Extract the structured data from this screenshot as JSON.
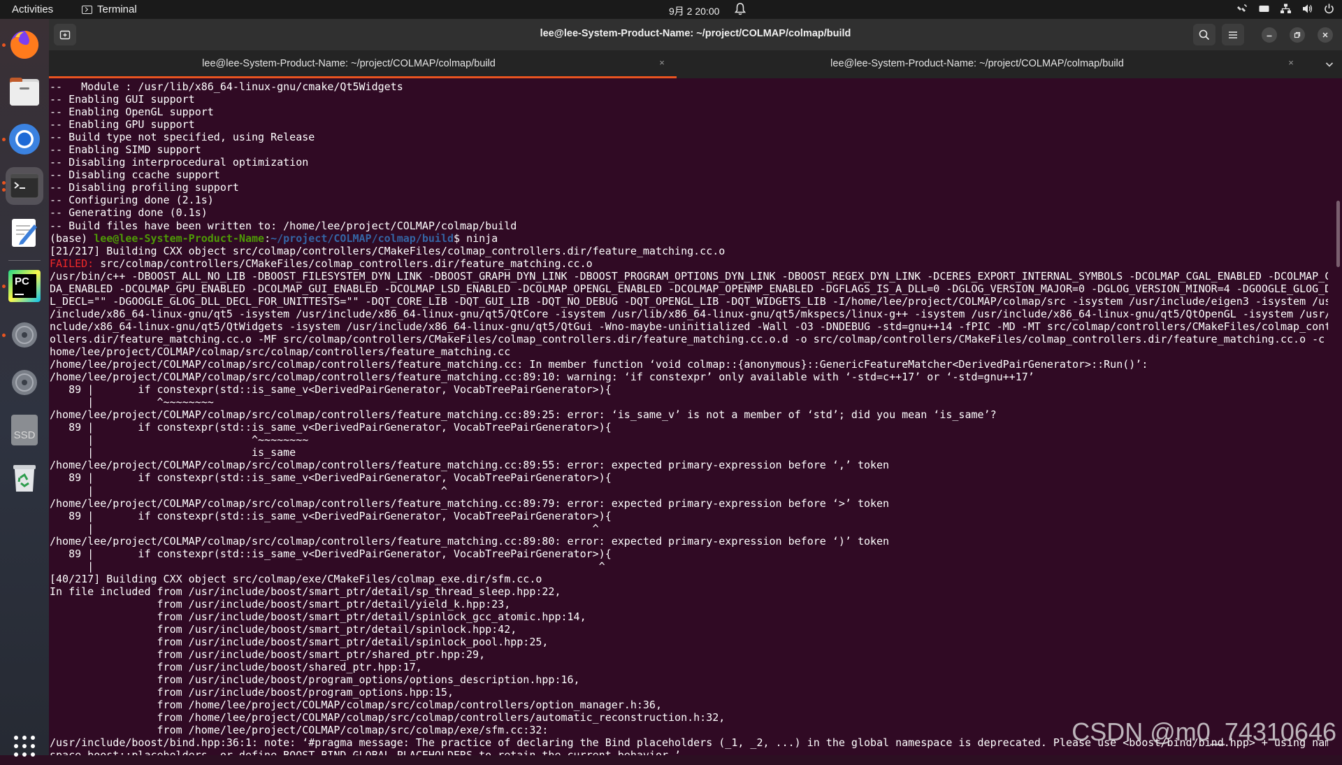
{
  "topbar": {
    "activities": "Activities",
    "app_name": "Terminal",
    "clock": "9月 2  20:00"
  },
  "dock": {
    "items": [
      "firefox-icon",
      "files-icon",
      "chromium-icon",
      "terminal-icon",
      "text-editor-icon",
      "pycharm-icon",
      "disc-icon",
      "disc-icon",
      "ssd-drive-icon",
      "trash-icon",
      "show-apps-icon"
    ],
    "ssd_label": "SSD",
    "pycharm_label": "PC"
  },
  "window": {
    "title": "lee@lee-System-Product-Name: ~/project/COLMAP/colmap/build",
    "tabs": [
      {
        "label": "lee@lee-System-Product-Name: ~/project/COLMAP/colmap/build",
        "active": true
      },
      {
        "label": "lee@lee-System-Product-Name: ~/project/COLMAP/colmap/build",
        "active": false
      }
    ],
    "tab_close": "×"
  },
  "terminal": {
    "lines_before": [
      "--   Module : /usr/lib/x86_64-linux-gnu/cmake/Qt5Widgets",
      "-- Enabling GUI support",
      "-- Enabling OpenGL support",
      "-- Enabling GPU support",
      "-- Build type not specified, using Release",
      "-- Enabling SIMD support",
      "-- Disabling interprocedural optimization",
      "-- Disabling ccache support",
      "-- Disabling profiling support",
      "-- Configuring done (2.1s)",
      "-- Generating done (0.1s)",
      "-- Build files have been written to: /home/lee/project/COLMAP/colmap/build"
    ],
    "prompt": {
      "env": "(base) ",
      "user_host": "lee@lee-System-Product-Name",
      "colon": ":",
      "path": "~/project/COLMAP/colmap/build",
      "symbol": "$ ",
      "command": "ninja"
    },
    "build_line": "[21/217] Building CXX object src/colmap/controllers/CMakeFiles/colmap_controllers.dir/feature_matching.cc.o",
    "failed_label": "FAILED:",
    "failed_target": " src/colmap/controllers/CMakeFiles/colmap_controllers.dir/feature_matching.cc.o",
    "lines_after": [
      "/usr/bin/c++ -DBOOST_ALL_NO_LIB -DBOOST_FILESYSTEM_DYN_LINK -DBOOST_GRAPH_DYN_LINK -DBOOST_PROGRAM_OPTIONS_DYN_LINK -DBOOST_REGEX_DYN_LINK -DCERES_EXPORT_INTERNAL_SYMBOLS -DCOLMAP_CGAL_ENABLED -DCOLMAP_CU",
      "DA_ENABLED -DCOLMAP_GPU_ENABLED -DCOLMAP_GUI_ENABLED -DCOLMAP_LSD_ENABLED -DCOLMAP_OPENGL_ENABLED -DCOLMAP_OPENMP_ENABLED -DGFLAGS_IS_A_DLL=0 -DGLOG_VERSION_MAJOR=0 -DGLOG_VERSION_MINOR=4 -DGOOGLE_GLOG_DL",
      "L_DECL=\"\" -DGOOGLE_GLOG_DLL_DECL_FOR_UNITTESTS=\"\" -DQT_CORE_LIB -DQT_GUI_LIB -DQT_NO_DEBUG -DQT_OPENGL_LIB -DQT_WIDGETS_LIB -I/home/lee/project/COLMAP/colmap/src -isystem /usr/include/eigen3 -isystem /usr",
      "/include/x86_64-linux-gnu/qt5 -isystem /usr/include/x86_64-linux-gnu/qt5/QtCore -isystem /usr/lib/x86_64-linux-gnu/qt5/mkspecs/linux-g++ -isystem /usr/include/x86_64-linux-gnu/qt5/QtOpenGL -isystem /usr/i",
      "nclude/x86_64-linux-gnu/qt5/QtWidgets -isystem /usr/include/x86_64-linux-gnu/qt5/QtGui -Wno-maybe-uninitialized -Wall -O3 -DNDEBUG -std=gnu++14 -fPIC -MD -MT src/colmap/controllers/CMakeFiles/colmap_contr",
      "ollers.dir/feature_matching.cc.o -MF src/colmap/controllers/CMakeFiles/colmap_controllers.dir/feature_matching.cc.o.d -o src/colmap/controllers/CMakeFiles/colmap_controllers.dir/feature_matching.cc.o -c /",
      "home/lee/project/COLMAP/colmap/src/colmap/controllers/feature_matching.cc",
      "/home/lee/project/COLMAP/colmap/src/colmap/controllers/feature_matching.cc: In member function ‘void colmap::{anonymous}::GenericFeatureMatcher<DerivedPairGenerator>::Run()’:",
      "/home/lee/project/COLMAP/colmap/src/colmap/controllers/feature_matching.cc:89:10: warning: ‘if constexpr’ only available with ‘-std=c++17’ or ‘-std=gnu++17’",
      "   89 |       if constexpr(std::is_same_v<DerivedPairGenerator, VocabTreePairGenerator>){",
      "      |          ^~~~~~~~~",
      "/home/lee/project/COLMAP/colmap/src/colmap/controllers/feature_matching.cc:89:25: error: ‘is_same_v’ is not a member of ‘std’; did you mean ‘is_same’?",
      "   89 |       if constexpr(std::is_same_v<DerivedPairGenerator, VocabTreePairGenerator>){",
      "      |                         ^~~~~~~~~",
      "      |                         is_same",
      "/home/lee/project/COLMAP/colmap/src/colmap/controllers/feature_matching.cc:89:55: error: expected primary-expression before ‘,’ token",
      "   89 |       if constexpr(std::is_same_v<DerivedPairGenerator, VocabTreePairGenerator>){",
      "      |                                                       ^",
      "/home/lee/project/COLMAP/colmap/src/colmap/controllers/feature_matching.cc:89:79: error: expected primary-expression before ‘>’ token",
      "   89 |       if constexpr(std::is_same_v<DerivedPairGenerator, VocabTreePairGenerator>){",
      "      |                                                                               ^",
      "/home/lee/project/COLMAP/colmap/src/colmap/controllers/feature_matching.cc:89:80: error: expected primary-expression before ‘)’ token",
      "   89 |       if constexpr(std::is_same_v<DerivedPairGenerator, VocabTreePairGenerator>){",
      "      |                                                                                ^",
      "[40/217] Building CXX object src/colmap/exe/CMakeFiles/colmap_exe.dir/sfm.cc.o",
      "In file included from /usr/include/boost/smart_ptr/detail/sp_thread_sleep.hpp:22,",
      "                 from /usr/include/boost/smart_ptr/detail/yield_k.hpp:23,",
      "                 from /usr/include/boost/smart_ptr/detail/spinlock_gcc_atomic.hpp:14,",
      "                 from /usr/include/boost/smart_ptr/detail/spinlock.hpp:42,",
      "                 from /usr/include/boost/smart_ptr/detail/spinlock_pool.hpp:25,",
      "                 from /usr/include/boost/smart_ptr/shared_ptr.hpp:29,",
      "                 from /usr/include/boost/shared_ptr.hpp:17,",
      "                 from /usr/include/boost/program_options/options_description.hpp:16,",
      "                 from /usr/include/boost/program_options.hpp:15,",
      "                 from /home/lee/project/COLMAP/colmap/src/colmap/controllers/option_manager.h:36,",
      "                 from /home/lee/project/COLMAP/colmap/src/colmap/controllers/automatic_reconstruction.h:32,",
      "                 from /home/lee/project/COLMAP/colmap/src/colmap/exe/sfm.cc:32:",
      "/usr/include/boost/bind.hpp:36:1: note: ‘#pragma message: The practice of declaring the Bind placeholders (_1, _2, ...) in the global namespace is deprecated. Please use <boost/bind/bind.hpp> + using name",
      "space boost::placeholders, or define BOOST_BIND_GLOBAL_PLACEHOLDERS to retain the current behavior.’"
    ]
  },
  "watermark": "CSDN @m0_74310646",
  "colors": {
    "terminal_bg": "#300a24",
    "accent": "#e95420",
    "prompt_user": "#4e9a06",
    "prompt_path": "#3465a4",
    "failed": "#ef2929"
  }
}
